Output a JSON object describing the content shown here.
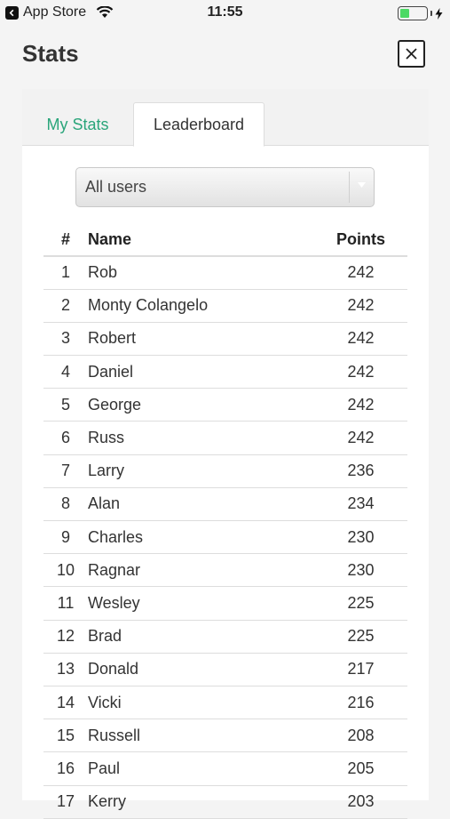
{
  "status_bar": {
    "back_label": "App Store",
    "time": "11:55"
  },
  "header": {
    "title": "Stats"
  },
  "tabs": [
    {
      "label": "My Stats",
      "active": false
    },
    {
      "label": "Leaderboard",
      "active": true
    }
  ],
  "filter": {
    "selected": "All users"
  },
  "table": {
    "headers": {
      "rank": "#",
      "name": "Name",
      "points": "Points"
    },
    "rows": [
      {
        "rank": "1",
        "name": "Rob",
        "points": "242"
      },
      {
        "rank": "2",
        "name": "Monty Colangelo",
        "points": "242"
      },
      {
        "rank": "3",
        "name": "Robert",
        "points": "242"
      },
      {
        "rank": "4",
        "name": "Daniel",
        "points": "242"
      },
      {
        "rank": "5",
        "name": "George",
        "points": "242"
      },
      {
        "rank": "6",
        "name": "Russ",
        "points": "242"
      },
      {
        "rank": "7",
        "name": "Larry",
        "points": "236"
      },
      {
        "rank": "8",
        "name": "Alan",
        "points": "234"
      },
      {
        "rank": "9",
        "name": "Charles",
        "points": "230"
      },
      {
        "rank": "10",
        "name": "Ragnar",
        "points": "230"
      },
      {
        "rank": "11",
        "name": "Wesley",
        "points": "225"
      },
      {
        "rank": "12",
        "name": "Brad",
        "points": "225"
      },
      {
        "rank": "13",
        "name": "Donald",
        "points": "217"
      },
      {
        "rank": "14",
        "name": "Vicki",
        "points": "216"
      },
      {
        "rank": "15",
        "name": "Russell",
        "points": "208"
      },
      {
        "rank": "16",
        "name": "Paul",
        "points": "205"
      },
      {
        "rank": "17",
        "name": "Kerry",
        "points": "203"
      }
    ]
  },
  "colors": {
    "accent_green": "#2aa57a",
    "battery_green": "#4cd964"
  },
  "icons": {
    "back": "chevron-left-icon",
    "wifi": "wifi-icon",
    "battery": "battery-icon",
    "charging": "bolt-icon",
    "close": "close-icon",
    "dropdown": "caret-down-icon"
  },
  "battery": {
    "level": 0.35
  }
}
